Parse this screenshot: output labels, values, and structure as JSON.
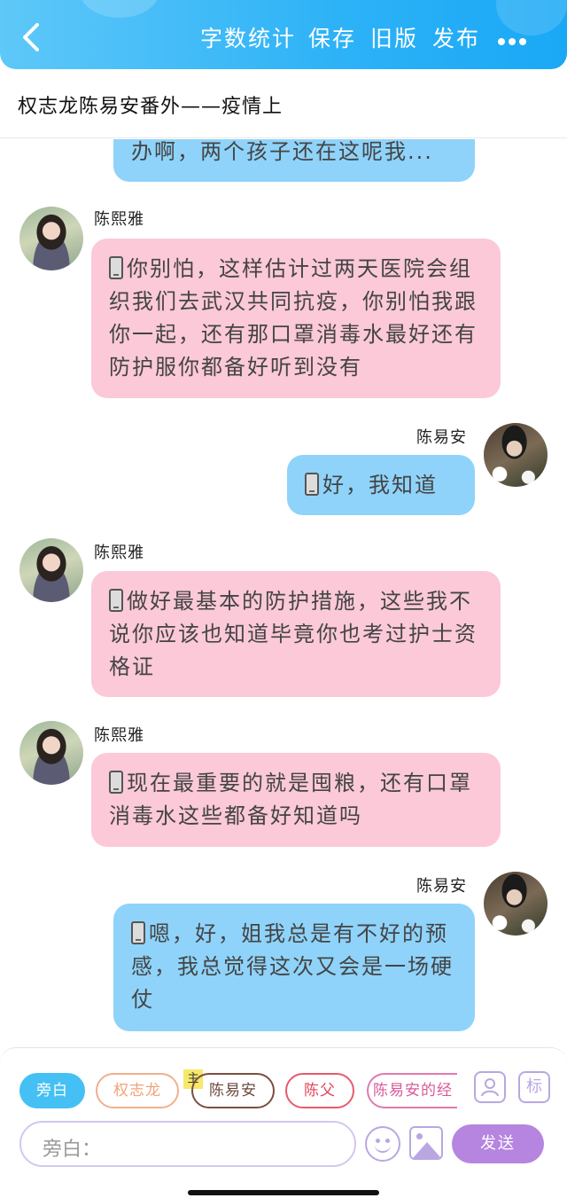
{
  "header": {
    "back_icon": "chevron-left-icon",
    "word_count": "字数统计",
    "save": "保存",
    "old_version": "旧版",
    "publish": "发布",
    "more_icon": "more-dots-icon"
  },
  "story_title": "权志龙陈易安番外——疫情上",
  "messages": [
    {
      "side": "right",
      "text": "办啊，两个孩子还在这呢我..."
    },
    {
      "side": "left",
      "name": "陈熙雅",
      "text": "你别怕，这样估计过两天医院会组织我们去武汉共同抗疫，你别怕我跟你一起，还有那口罩消毒水最好还有防护服你都备好听到没有"
    },
    {
      "side": "right",
      "name": "陈易安",
      "text": "好，我知道"
    },
    {
      "side": "left",
      "name": "陈熙雅",
      "text": "做好最基本的防护措施，这些我不说你应该也知道毕竟你也考过护士资格证"
    },
    {
      "side": "left",
      "name": "陈熙雅",
      "text": "现在最重要的就是囤粮，还有口罩消毒水这些都备好知道吗"
    },
    {
      "side": "right",
      "name": "陈易安",
      "text": "嗯，好，姐我总是有不好的预感，我总觉得这次又会是一场硬仗"
    }
  ],
  "roles": [
    "旁白",
    "权志龙",
    "陈易安",
    "陈父",
    "陈易安的经"
  ],
  "host_badge": "主",
  "side_icons": {
    "profile": "person-card-icon",
    "tag": "标"
  },
  "input": {
    "placeholder": "旁白："
  },
  "send": "发送",
  "colors": {
    "header_start": "#5ec8f8",
    "header_end": "#1aa8f5",
    "pink_bubble": "#fbc9d8",
    "blue_bubble": "#8fd3fa",
    "accent_purple": "#b685e0"
  }
}
